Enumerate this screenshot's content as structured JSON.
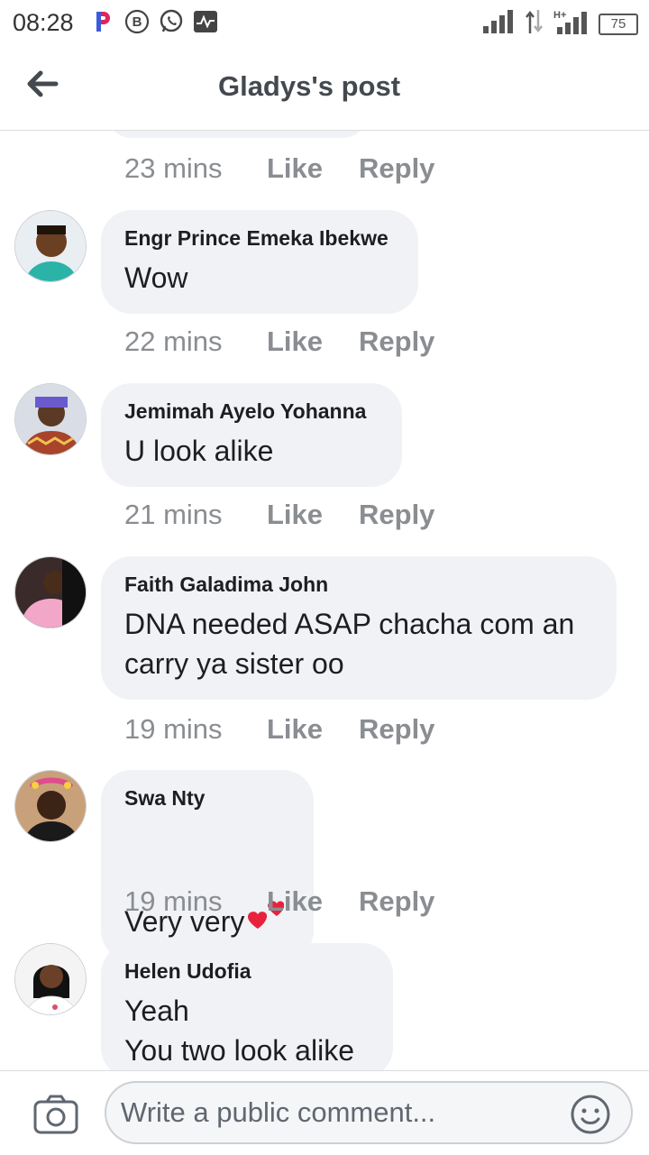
{
  "status": {
    "time": "08:28",
    "battery": "75",
    "network": "H+"
  },
  "header": {
    "title": "Gladys's post"
  },
  "top_meta": {
    "time": "23 mins",
    "like": "Like",
    "reply": "Reply"
  },
  "comments": [
    {
      "author": "Engr Prince Emeka Ibekwe",
      "text": "Wow",
      "time": "22 mins",
      "like": "Like",
      "reply": "Reply"
    },
    {
      "author": "Jemimah Ayelo Yohanna",
      "text": "U look alike",
      "time": "21 mins",
      "like": "Like",
      "reply": "Reply"
    },
    {
      "author": "Faith Galadima John",
      "text": "DNA needed ASAP chacha com an\ncarry ya sister oo",
      "time": "19 mins",
      "like": "Like",
      "reply": "Reply"
    },
    {
      "author": "Swa Nty",
      "text": "Very very",
      "time": "19 mins",
      "like": "Like",
      "reply": "Reply"
    },
    {
      "author": "Helen Udofia",
      "text": "Yeah\nYou two look alike",
      "time": "",
      "like": "",
      "reply": ""
    }
  ],
  "composer": {
    "placeholder": "Write a public comment..."
  },
  "colors": {
    "bubble": "#f0f2f5",
    "meta": "#8a8d91",
    "title": "#444950"
  },
  "icons": [
    "back-arrow-icon",
    "camera-icon",
    "emoji-icon",
    "two-hearts-icon"
  ]
}
